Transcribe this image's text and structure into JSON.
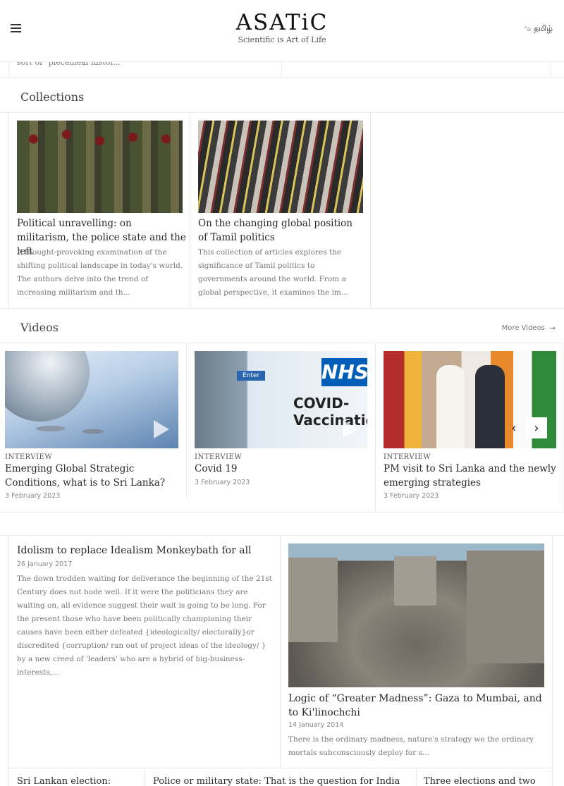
{
  "header": {
    "logo_title": "ASATiC",
    "logo_tagline": "Scientific is Art of Life",
    "language_label": "தமிழ்",
    "language_icon": "translate-icon",
    "menu_icon": "hamburger-menu-icon"
  },
  "previous_row": {
    "excerpt": "sort of \"piecemeal histor..."
  },
  "collections": {
    "heading": "Collections",
    "items": [
      {
        "title": "Political unravelling: on militarism, the police state and the left",
        "description": "A thought-provoking examination of the shifting political landscape in today's world. The authors delve into the trend of increasing militarism and th..."
      },
      {
        "title": "On the changing global position of Tamil politics",
        "description": "This collection of articles explores the significance of Tamil politics to governments around the world. From a global perspective, it examines the im..."
      }
    ]
  },
  "videos": {
    "heading": "Videos",
    "more_label": "More Videos",
    "items": [
      {
        "tag": "INTERVIEW",
        "title": "Emerging Global Strategic Conditions, what is to Sri Lanka?",
        "date": "3 February 2023"
      },
      {
        "tag": "INTERVIEW",
        "title": "Covid 19",
        "date": "3 February 2023",
        "image_sign": "Enter",
        "image_logo": "NHS",
        "image_caption_1": "COVID-",
        "image_caption_2": "Vaccination Cen"
      },
      {
        "tag": "INTERVIEW",
        "title": "PM visit to Sri Lanka and the newly emerging strategies",
        "date": "3 February 2023"
      }
    ],
    "prev_glyph": "‹",
    "next_glyph": "›"
  },
  "articles": {
    "left": {
      "title": "Idolism to replace Idealism Monkeybath for all",
      "date": "26 January 2017",
      "body": "The down trodden waiting for deliverance the beginning of the 21st Century does not bode well. If it were the politicians they are waiting on, all evidence suggest their wait is going to be long. For the present those who have been politically championing their causes have been either defeated {ideologically/ electorally}or discredited {corruption/ ran out of project ideas of the ideology/ } by a new creed of 'leaders' who are a hybrid of big-business-interests,..."
    },
    "right": {
      "title": "Logic of “Greater Madness”: Gaza to Mumbai, and to Ki'linochchi",
      "date": "14 January 2014",
      "body": "There is the ordinary madness, nature's strategy we the ordinary mortals subconsciously deploy for s..."
    }
  },
  "bottom_row": [
    {
      "title": "Sri Lankan election:"
    },
    {
      "title": "Police or military state: That is the question for India"
    },
    {
      "title": "Three elections and two"
    }
  ]
}
